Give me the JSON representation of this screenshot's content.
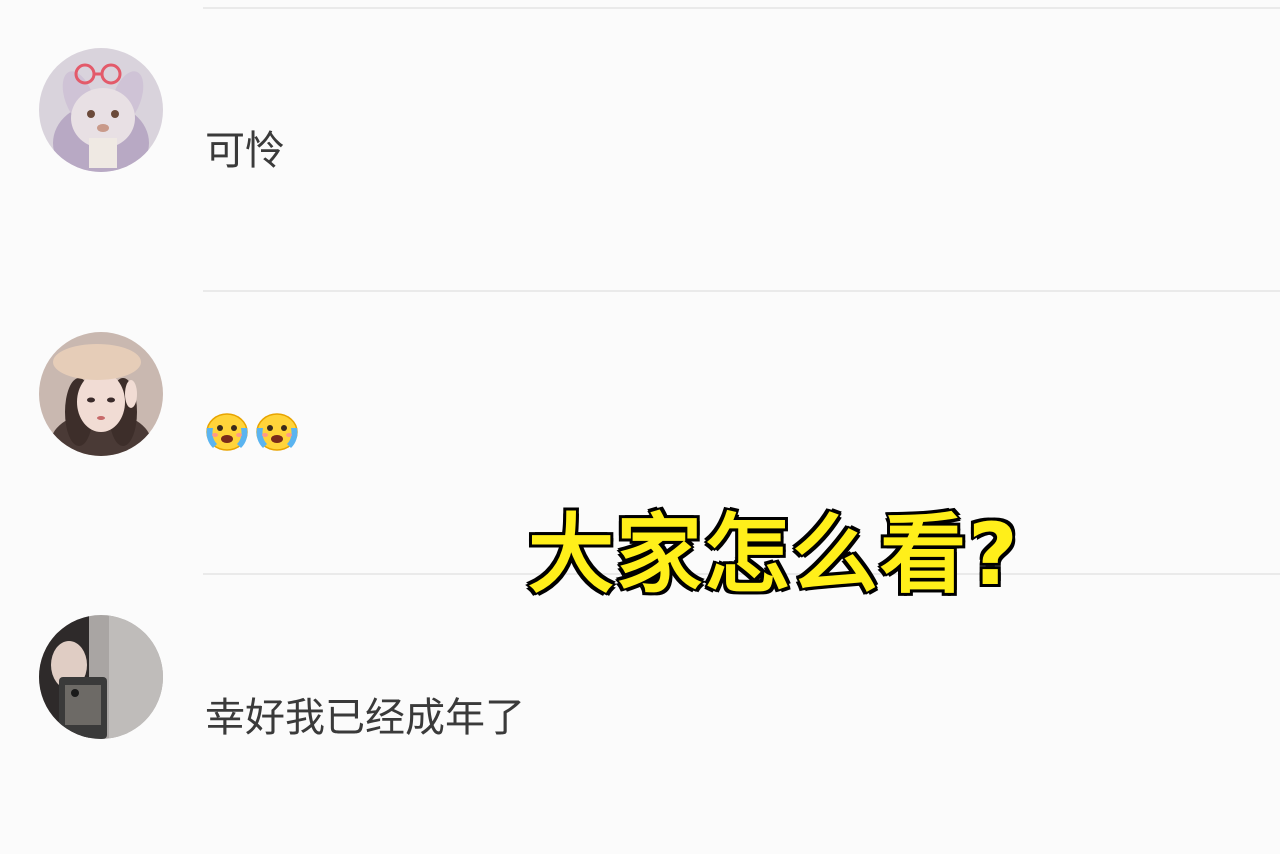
{
  "comments": [
    {
      "avatar": "avatar-bunny-hat",
      "text": "可怜"
    },
    {
      "avatar": "avatar-girl-beret",
      "emoji": [
        "crying-face-emoji",
        "crying-face-emoji"
      ]
    },
    {
      "avatar": "avatar-girl-phone",
      "text": "幸好我已经成年了"
    }
  ],
  "overlay": {
    "caption": "大家怎么看?"
  },
  "colors": {
    "background": "#fbfbfb",
    "caption_fill": "#ffef1a",
    "caption_stroke": "#000000",
    "divider": "#eaeaea"
  }
}
